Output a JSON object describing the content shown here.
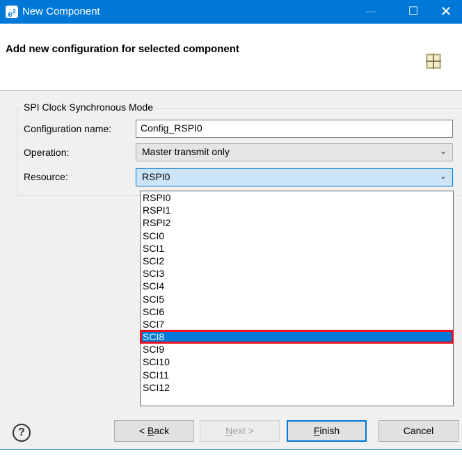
{
  "window": {
    "app_badge": "e",
    "app_badge_sup": "2",
    "title": "New Component",
    "minimize_glyph": "—",
    "maximize_glyph": "☐",
    "close_glyph": "✕"
  },
  "header": {
    "title": "Add new configuration for selected component",
    "icon": "component-grid-icon"
  },
  "group": {
    "legend": "SPI Clock Synchronous Mode",
    "config_name_label": "Configuration name:",
    "config_name_value": "Config_RSPI0",
    "operation_label": "Operation:",
    "operation_value": "Master transmit only",
    "resource_label": "Resource:",
    "resource_value": "RSPI0"
  },
  "resource_options": [
    "RSPI0",
    "RSPI1",
    "RSPI2",
    "SCI0",
    "SCI1",
    "SCI2",
    "SCI3",
    "SCI4",
    "SCI5",
    "SCI6",
    "SCI7",
    "SCI8",
    "SCI9",
    "SCI10",
    "SCI11",
    "SCI12"
  ],
  "selected_option": "SCI8",
  "footer": {
    "help_glyph": "?",
    "back_pre": "< ",
    "back_mnemonic": "B",
    "back_post": "ack",
    "next_mnemonic": "N",
    "next_post": "ext >",
    "finish_mnemonic": "F",
    "finish_post": "inish",
    "cancel": "Cancel"
  },
  "colors": {
    "titlebar": "#0078d7",
    "selection": "#0078d7",
    "highlight_box": "#e81123"
  }
}
